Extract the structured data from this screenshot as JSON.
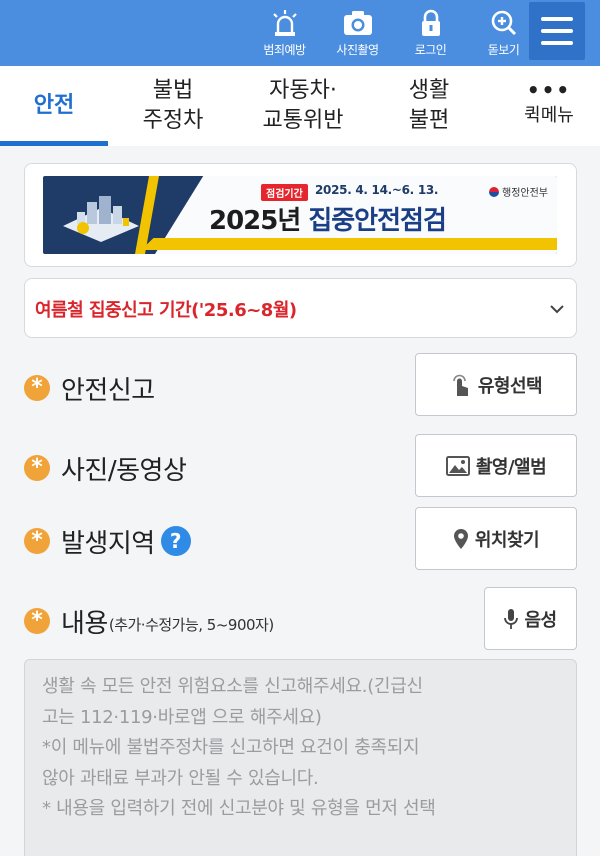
{
  "header": {
    "items": [
      {
        "label": "범죄예방",
        "icon": "siren-icon"
      },
      {
        "label": "사진촬영",
        "icon": "camera-icon"
      },
      {
        "label": "로그인",
        "icon": "lock-icon"
      },
      {
        "label": "돋보기",
        "icon": "zoom-icon"
      }
    ],
    "menu_icon": "hamburger-icon",
    "colors": {
      "bar": "#4b8ee0",
      "menu_button": "#2f72c8"
    }
  },
  "tabs": [
    {
      "line1": "안전",
      "line2": "",
      "active": true
    },
    {
      "line1": "불법",
      "line2": "주정차",
      "active": false
    },
    {
      "line1": "자동차·",
      "line2": "교통위반",
      "active": false
    },
    {
      "line1": "생활",
      "line2": "불편",
      "active": false
    },
    {
      "line1": "•••",
      "line2": "퀵메뉴",
      "active": false
    }
  ],
  "banner": {
    "period_tag": "점검기간",
    "period": "2025. 4. 14.~6. 13.",
    "ministry": "행정안전부",
    "headline_prefix": "2025년 ",
    "headline_highlight": "집중안전점검"
  },
  "notice": {
    "text": "여름철 집중신고 기간('25.6~8월)",
    "color": "#d9262c",
    "icon": "chevron-down-icon"
  },
  "form": {
    "required_mark": "*",
    "safety_report": {
      "label": "안전신고",
      "button": "유형선택",
      "button_icon": "touch-icon"
    },
    "media": {
      "label": "사진/동영상",
      "button": "촬영/앨범",
      "button_icon": "image-icon"
    },
    "location": {
      "label": "발생지역",
      "help": "?",
      "button": "위치찾기",
      "button_icon": "location-pin-icon"
    },
    "content": {
      "label": "내용",
      "sub": "(추가·수정가능, 5~900자)",
      "button": "음성",
      "button_icon": "microphone-icon",
      "placeholder_lines": [
        "생활 속 모든 안전 위험요소를 신고해주세요.(긴급신",
        "고는 112·119·바로앱 으로 해주세요)",
        "*이 메뉴에 불법주정차를 신고하면 요건이 충족되지",
        "않아 과태료 부과가 안될 수 있습니다.",
        "* 내용을 입력하기 전에 신고분야 및 유형을 먼저 선택"
      ]
    }
  }
}
